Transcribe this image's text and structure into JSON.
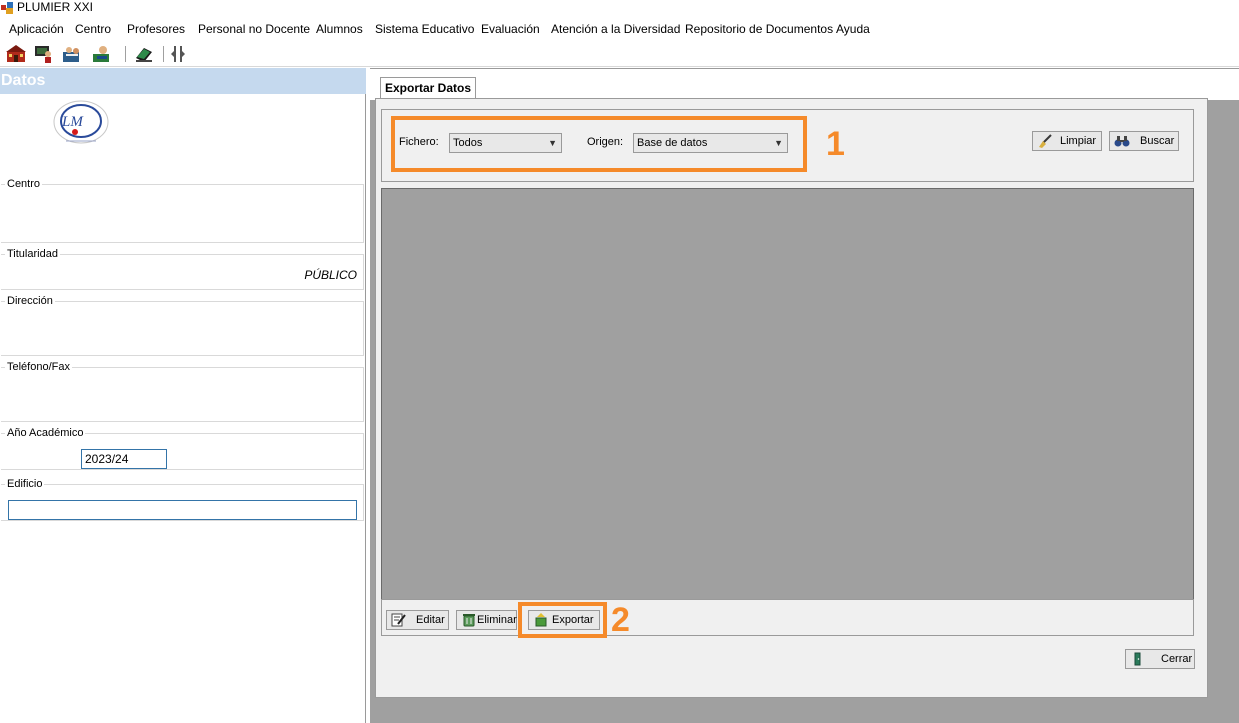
{
  "window": {
    "title": "PLUMIER XXI"
  },
  "menu": [
    "Aplicación",
    "Centro",
    "Profesores",
    "Personal no Docente",
    "Alumnos",
    "Sistema Educativo",
    "Evaluación",
    "Atención a la Diversidad",
    "Repositorio de Documentos",
    "Ayuda"
  ],
  "toolbar": {
    "icons": [
      "school-icon",
      "teacher-icon",
      "student-icon",
      "staff-icon",
      "export-icon",
      "splitter-icon"
    ]
  },
  "left_panel": {
    "header": "Datos",
    "logo_letters": "LM",
    "centro_label": "Centro",
    "centro_value": "",
    "titularidad_label": "Titularidad",
    "titularidad_value": "PÚBLICO",
    "direccion_label": "Dirección",
    "telefono_label": "Teléfono/Fax",
    "anio_label": "Año Académico",
    "anio_value": "2023/24",
    "edificio_label": "Edificio",
    "edificio_value": ""
  },
  "tabs": [
    {
      "label": "Exportar Datos",
      "active": true
    }
  ],
  "filters": {
    "fichero_label": "Fichero:",
    "fichero_value": "Todos",
    "origen_label": "Origen:",
    "origen_value": "Base de datos",
    "limpiar_label": "Limpiar",
    "buscar_label": "Buscar"
  },
  "actions": {
    "editar_label": "Editar",
    "eliminar_label": "Eliminar",
    "exportar_label": "Exportar",
    "cerrar_label": "Cerrar"
  },
  "annotations": {
    "one": "1",
    "two": "2"
  },
  "colors": {
    "highlight": "#f58a2a",
    "header_bg": "#c5d9ee",
    "grid_bg": "#a0a0a0",
    "input_border": "#3474a8"
  }
}
